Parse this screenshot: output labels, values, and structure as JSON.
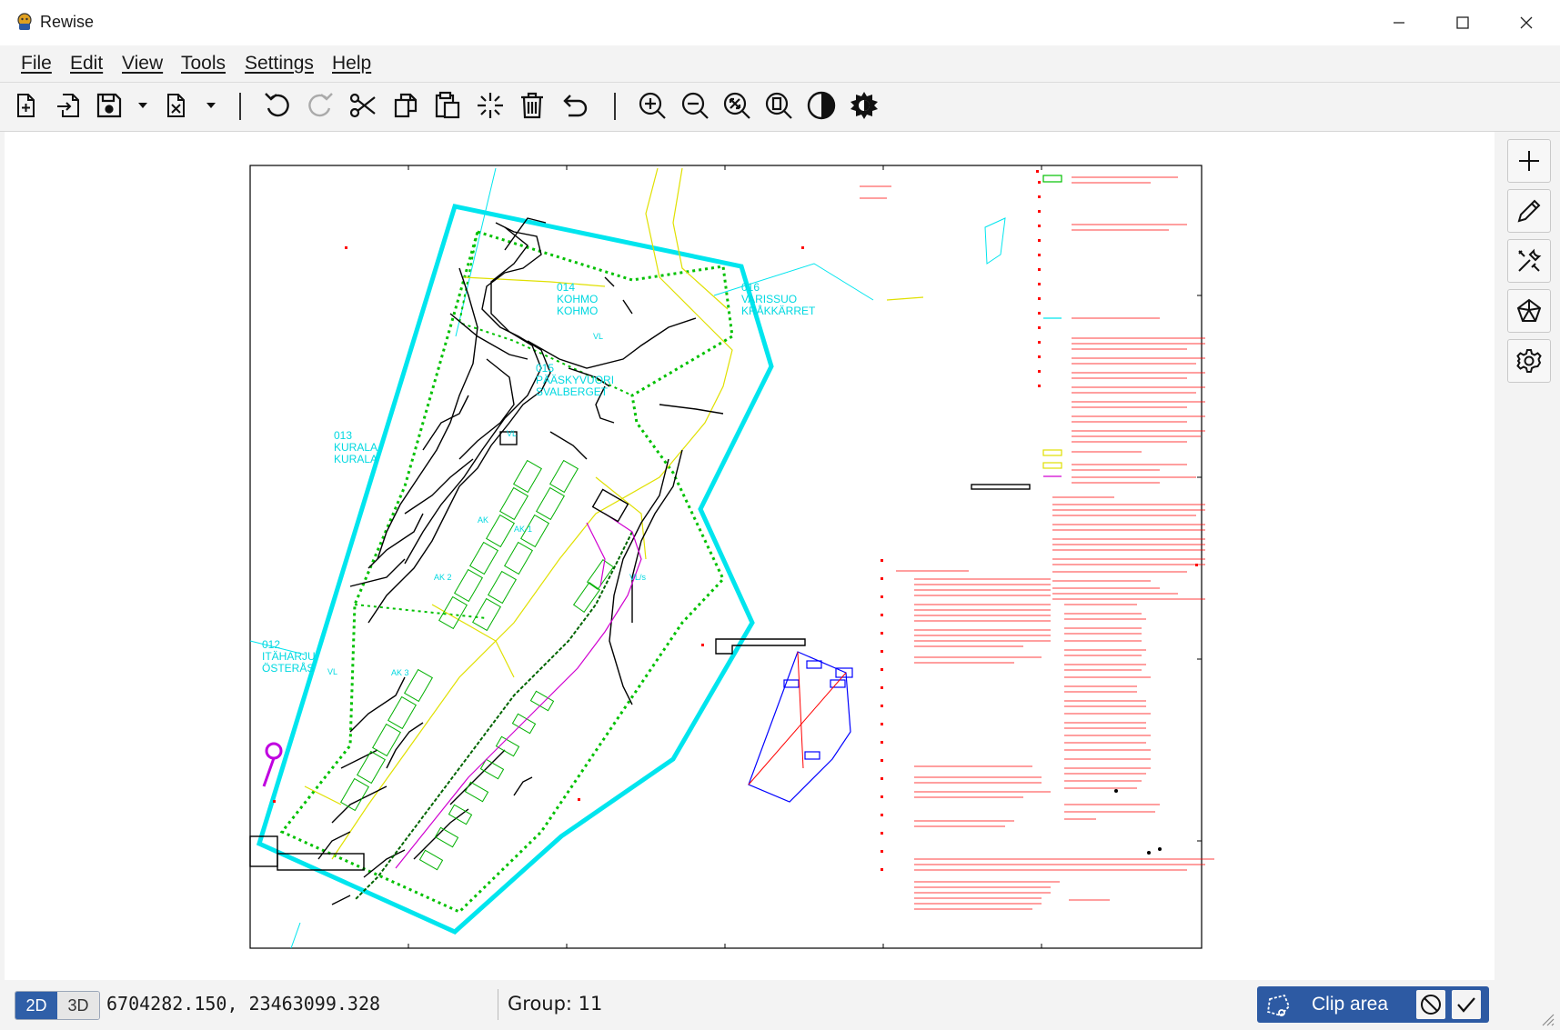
{
  "app": {
    "title": "Rewise",
    "icon": "rewise-logo-icon"
  },
  "window_controls": [
    "minimize-icon",
    "maximize-icon",
    "close-icon"
  ],
  "menu": {
    "items": [
      "File",
      "Edit",
      "View",
      "Tools",
      "Settings",
      "Help"
    ]
  },
  "toolbar": {
    "buttons": [
      "new-file-icon",
      "import-icon",
      "save-icon",
      "chevron-down-icon",
      "close-file-icon",
      "chevron-down-icon",
      "undo-icon",
      "redo-icon",
      "cut-icon",
      "copy-icon",
      "paste-icon",
      "select-all-icon",
      "delete-icon",
      "revert-icon",
      "zoom-in-icon",
      "zoom-out-icon",
      "zoom-fit-icon",
      "zoom-page-icon",
      "contrast-icon",
      "brightness-icon"
    ]
  },
  "sidepanel": {
    "buttons": [
      "add-icon",
      "edit-pencil-icon",
      "tools-icon",
      "shape-icon",
      "settings-gear-icon"
    ]
  },
  "drawing": {
    "labels": [
      {
        "code": "014",
        "fi": "KOHMO",
        "sv": "KOHMO"
      },
      {
        "code": "016",
        "fi": "VARISSUO",
        "sv": "KRÅKKÄRRET"
      },
      {
        "code": "015",
        "fi": "PÄÄSKYVUORI",
        "sv": "SVALBERGET"
      },
      {
        "code": "013",
        "fi": "KURALA",
        "sv": "KURALA"
      },
      {
        "code": "012",
        "fi": "ITÄHARJU",
        "sv": "ÖSTERÅS"
      }
    ],
    "zone_labels": [
      "VL",
      "VL",
      "AK 2",
      "AK-1",
      "VL/s",
      "VL",
      "AK 3",
      "AK"
    ],
    "colors": {
      "boundary": "#00e5ee",
      "zone_border": "#00c000",
      "ink": "#000000",
      "annotation": "#ff0000",
      "road": "#e0e000",
      "blue_map": "#0000ff",
      "marker": "#c000e0"
    }
  },
  "status": {
    "mode_2d": "2D",
    "mode_3d": "3D",
    "coordinates": "6704282.150, 23463099.328",
    "group": "Group: 11",
    "clip_label": "Clip area"
  }
}
